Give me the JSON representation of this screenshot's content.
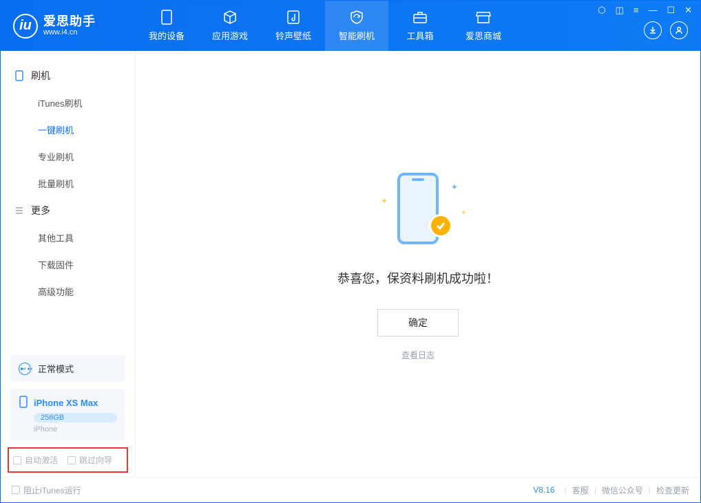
{
  "app": {
    "name": "爱思助手",
    "url": "www.i4.cn"
  },
  "topTabs": [
    {
      "label": "我的设备",
      "icon": "device-icon"
    },
    {
      "label": "应用游戏",
      "icon": "cube-icon"
    },
    {
      "label": "铃声壁纸",
      "icon": "music-note-icon"
    },
    {
      "label": "智能刷机",
      "icon": "refresh-shield-icon",
      "active": true
    },
    {
      "label": "工具箱",
      "icon": "toolbox-icon"
    },
    {
      "label": "爱思商城",
      "icon": "store-icon"
    }
  ],
  "sidebar": {
    "section1": {
      "title": "刷机",
      "items": [
        "iTunes刷机",
        "一键刷机",
        "专业刷机",
        "批量刷机"
      ],
      "activeIndex": 1
    },
    "section2": {
      "title": "更多",
      "items": [
        "其他工具",
        "下载固件",
        "高级功能"
      ]
    }
  },
  "modeBox": {
    "label": "正常模式"
  },
  "deviceBox": {
    "name": "iPhone XS Max",
    "storage": "256GB",
    "type": "iPhone"
  },
  "options": {
    "autoActivate": "自动激活",
    "skipGuide": "跳过向导"
  },
  "main": {
    "successTitle": "恭喜您，保资料刷机成功啦！",
    "okButton": "确定",
    "viewLog": "查看日志"
  },
  "footer": {
    "blockItunes": "阻止iTunes运行",
    "version": "V8.16",
    "links": [
      "客服",
      "微信公众号",
      "检查更新"
    ]
  }
}
